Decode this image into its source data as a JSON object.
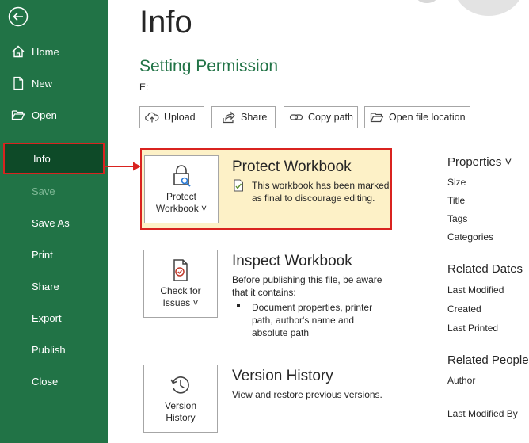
{
  "sidebar": {
    "items": [
      {
        "label": "Home",
        "icon": "home-icon"
      },
      {
        "label": "New",
        "icon": "new-document-icon"
      },
      {
        "label": "Open",
        "icon": "folder-open-icon"
      },
      {
        "label": "Info"
      },
      {
        "label": "Save"
      },
      {
        "label": "Save As"
      },
      {
        "label": "Print"
      },
      {
        "label": "Share"
      },
      {
        "label": "Export"
      },
      {
        "label": "Publish"
      },
      {
        "label": "Close"
      }
    ]
  },
  "main": {
    "title": "Info",
    "document_name": "Setting Permission",
    "document_path": "E:",
    "toolbar": {
      "upload": "Upload",
      "share": "Share",
      "copy_path": "Copy path",
      "open_location": "Open file location"
    },
    "protect": {
      "button_line1": "Protect",
      "button_line2": "Workbook ˅",
      "title": "Protect Workbook",
      "desc_line1": "This workbook has been marked",
      "desc_line2": "as final to discourage editing."
    },
    "inspect": {
      "button_line1": "Check for",
      "button_line2": "Issues ˅",
      "title": "Inspect Workbook",
      "desc_line1": "Before publishing this file, be aware",
      "desc_line2": "that it contains:",
      "bullet_line1": "Document properties, printer",
      "bullet_line2": "path, author's name and",
      "bullet_line3": "absolute path"
    },
    "version": {
      "button_line1": "Version",
      "button_line2": "History",
      "title": "Version History",
      "desc": "View and restore previous versions."
    }
  },
  "properties": {
    "heading": "Properties ˅",
    "items": [
      "Size",
      "Title",
      "Tags",
      "Categories"
    ],
    "dates_heading": "Related Dates",
    "dates": [
      "Last Modified",
      "Created",
      "Last Printed"
    ],
    "people_heading": "Related People",
    "people": [
      "Author",
      "Last Modified By"
    ]
  },
  "colors": {
    "sidebar": "#217346",
    "active_item": "#0e4a28",
    "highlight": "#d9231f",
    "protect_panel": "#fdf1c7"
  }
}
